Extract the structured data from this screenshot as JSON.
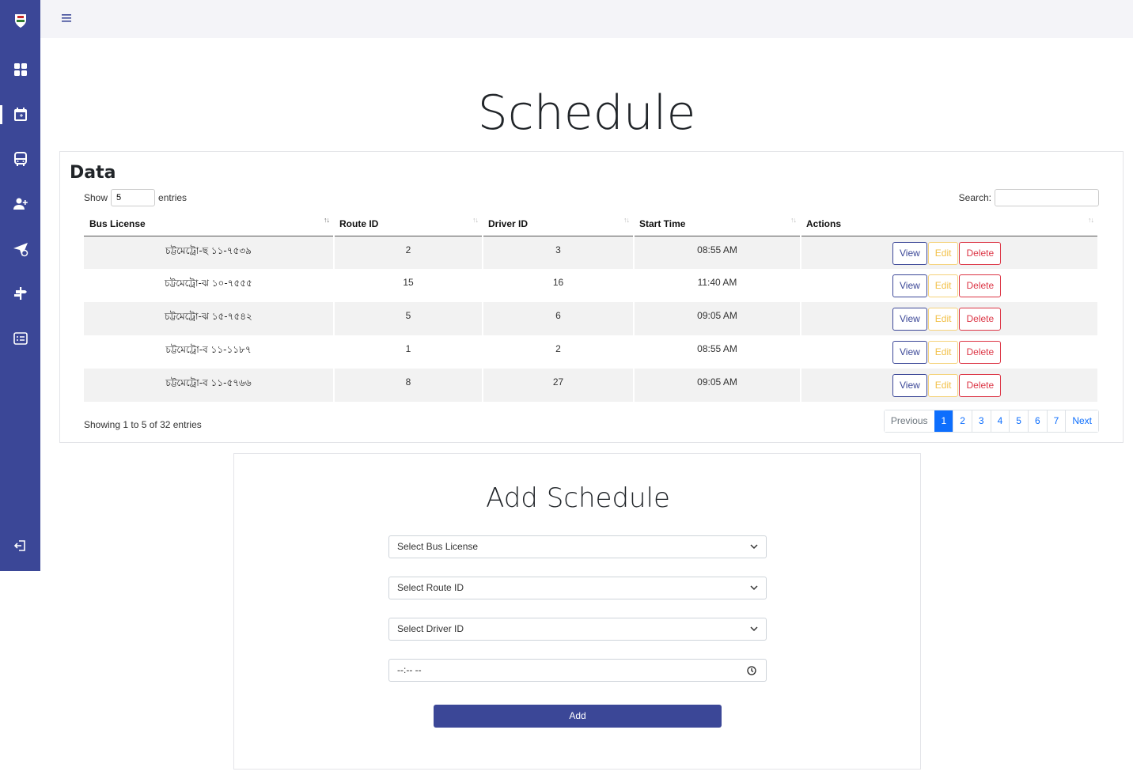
{
  "sidebar": {
    "items": [
      {
        "icon": "dashboard-icon"
      },
      {
        "icon": "calendar-icon",
        "active": true
      },
      {
        "icon": "bus-icon"
      },
      {
        "icon": "add-user-icon"
      },
      {
        "icon": "send-icon"
      },
      {
        "icon": "signpost-icon"
      },
      {
        "icon": "list-card-icon"
      }
    ],
    "logout_icon": "logout-icon"
  },
  "topbar": {
    "menu_icon": "hamburger-icon"
  },
  "page": {
    "title": "Schedule"
  },
  "data_card": {
    "title": "Data",
    "length_prefix": "Show",
    "length_value": "5",
    "length_suffix": "entries",
    "search_label": "Search:",
    "columns": [
      "Bus License",
      "Route ID",
      "Driver ID",
      "Start Time",
      "Actions"
    ],
    "rows": [
      {
        "bus_license": "চট্টমেট্রো-ছ ১১-৭৫৩৯",
        "route_id": "2",
        "driver_id": "3",
        "start_time": "08:55 AM"
      },
      {
        "bus_license": "চট্টমেট্রো-ঝ ১০-৭৫৫৫",
        "route_id": "15",
        "driver_id": "16",
        "start_time": "11:40 AM"
      },
      {
        "bus_license": "চট্টমেট্রো-ঝ ১৫-৭৫৪২",
        "route_id": "5",
        "driver_id": "6",
        "start_time": "09:05 AM"
      },
      {
        "bus_license": "চট্টমেট্রো-ব ১১-১১৮৭",
        "route_id": "1",
        "driver_id": "2",
        "start_time": "08:55 AM"
      },
      {
        "bus_license": "চট্টমেট্রো-ব ১১-৫৭৬৬",
        "route_id": "8",
        "driver_id": "27",
        "start_time": "09:05 AM"
      }
    ],
    "actions": {
      "view": "View",
      "edit": "Edit",
      "delete": "Delete"
    },
    "info": "Showing 1 to 5 of 32 entries",
    "pagination": {
      "previous": "Previous",
      "pages": [
        "1",
        "2",
        "3",
        "4",
        "5",
        "6",
        "7"
      ],
      "active": "1",
      "next": "Next"
    }
  },
  "add_card": {
    "title": "Add Schedule",
    "bus_select": "Select Bus License",
    "route_select": "Select Route ID",
    "driver_select": "Select Driver ID",
    "time_value": "--:-- --",
    "add_button": "Add"
  },
  "colors": {
    "primary": "#3b4797",
    "danger": "#dc3545",
    "warning": "#f2c14a",
    "link": "#0d6efd"
  }
}
